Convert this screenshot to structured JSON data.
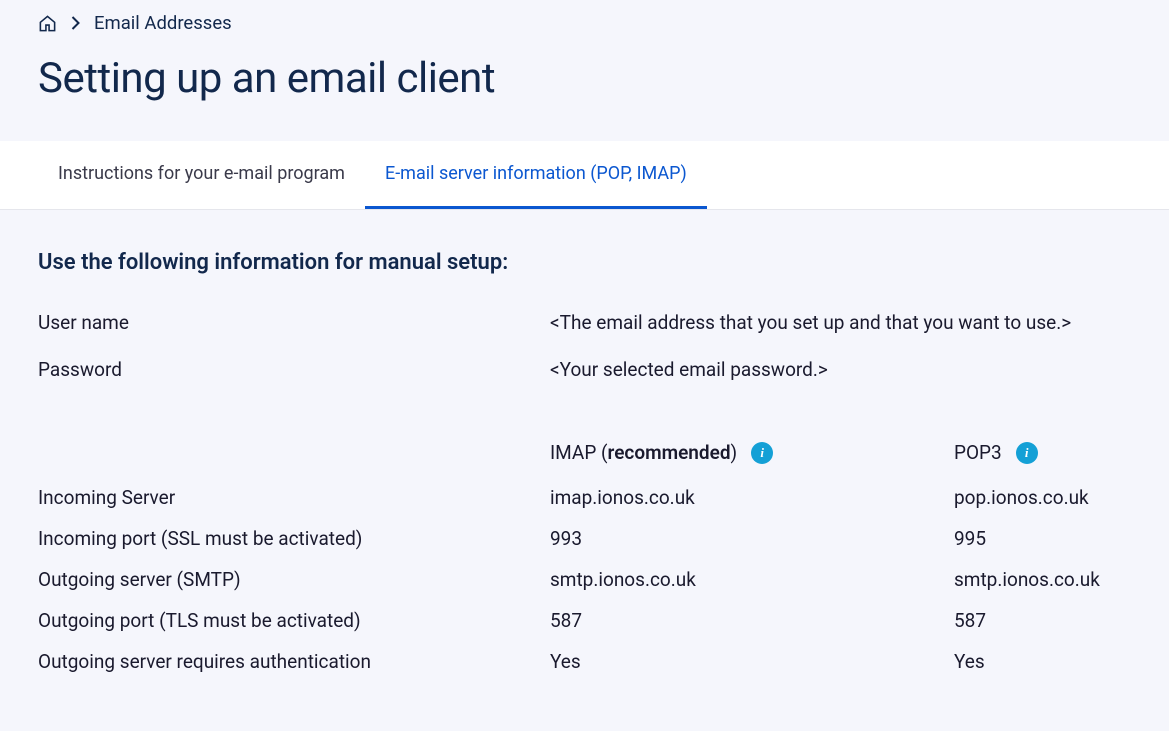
{
  "breadcrumb": {
    "item": "Email Addresses"
  },
  "page_title": "Setting up an email client",
  "tabs": {
    "instructions": "Instructions for your e-mail program",
    "server_info": "E-mail server information (POP, IMAP)"
  },
  "content": {
    "heading": "Use the following information for manual setup:",
    "credentials": {
      "username_label": "User name",
      "username_value": "<The email address that you set up and that you want to use.>",
      "password_label": "Password",
      "password_value": "<Your selected email password.>"
    },
    "server": {
      "imap_header_prefix": "IMAP (",
      "imap_header_bold": "recommended",
      "imap_header_suffix": ")",
      "pop_header": "POP3",
      "rows": {
        "incoming_server": {
          "label": "Incoming Server",
          "imap": "imap.ionos.co.uk",
          "pop": "pop.ionos.co.uk"
        },
        "incoming_port": {
          "label": "Incoming port (SSL must be activated)",
          "imap": "993",
          "pop": "995"
        },
        "outgoing_server": {
          "label": "Outgoing server (SMTP)",
          "imap": "smtp.ionos.co.uk",
          "pop": "smtp.ionos.co.uk"
        },
        "outgoing_port": {
          "label": "Outgoing port (TLS must be activated)",
          "imap": "587",
          "pop": "587"
        },
        "auth": {
          "label": "Outgoing server requires authentication",
          "imap": "Yes",
          "pop": "Yes"
        }
      }
    }
  }
}
